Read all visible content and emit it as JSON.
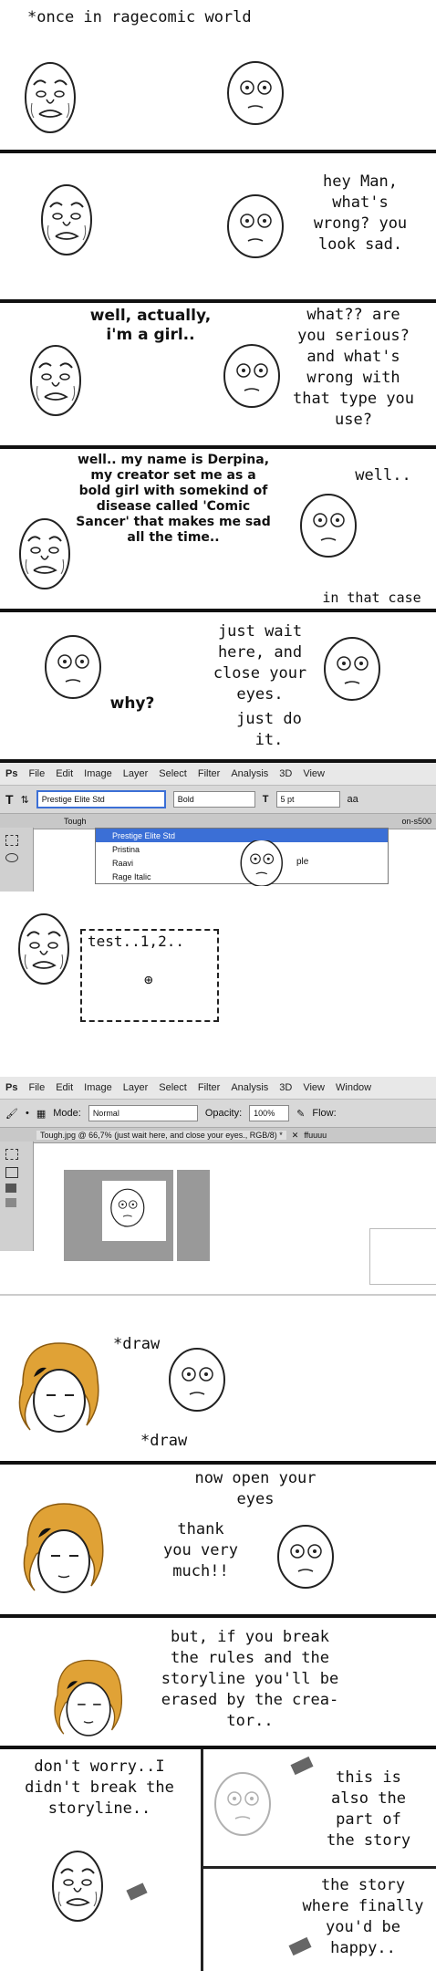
{
  "panels": {
    "p1": {
      "caption": "*once in ragecomic world"
    },
    "p2": {
      "speech": "hey Man,\nwhat's\nwrong? you\nlook sad."
    },
    "p3": {
      "girl": "well, actually,\ni'm a girl..",
      "man": "what?? are\nyou serious?\nand what's\nwrong with\nthat type you\nuse?"
    },
    "p4": {
      "girl": "well.. my name is Derpina,\nmy creator set me as a\nbold girl with somekind of\ndisease called 'Comic\nSancer' that makes me sad\nall the time..",
      "man1": "well..",
      "man2": "in that case"
    },
    "p5": {
      "man": "just wait\nhere, and\nclose your\neyes.",
      "girl": "why?",
      "man2": "just do\nit."
    },
    "p6": {
      "menu": [
        "File",
        "Edit",
        "Image",
        "Layer",
        "Select",
        "Filter",
        "Analysis",
        "3D",
        "View"
      ],
      "font_value": "Prestige Elite Std",
      "style_value": "Bold",
      "size_value": "5 pt",
      "aa": "aa",
      "tab_left": "Tough",
      "tab_right": "on-s500",
      "fonts": [
        "Prestige Elite Std",
        "Pristina",
        "Raavi",
        "Rage Italic"
      ],
      "side_a": "ple",
      "side_b": "ple"
    },
    "p7": {
      "textbox": "test..1,2.."
    },
    "p8": {
      "menu": [
        "File",
        "Edit",
        "Image",
        "Layer",
        "Select",
        "Filter",
        "Analysis",
        "3D",
        "View",
        "Window"
      ],
      "mode_label": "Mode:",
      "mode_value": "Normal",
      "opacity_label": "Opacity:",
      "opacity_value": "100%",
      "flow_label": "Flow:",
      "tab_title": "Tough.jpg @ 66,7% (just wait here, and close your eyes., RGB/8) *",
      "tab_right": "ffuuuu"
    },
    "p9": {
      "draw1": "*draw",
      "draw2": "*draw"
    },
    "p10": {
      "man": "now open your\neyes",
      "girl": "thank\nyou very\nmuch!!"
    },
    "p11": {
      "man": "but, if you break\nthe rules and the\nstoryline you'll be\nerased by the crea-\ntor.."
    },
    "p12": {
      "girl": "don't worry..I\ndidn't break the\nstoryline..",
      "man1": "this is\nalso the\npart of\nthe story",
      "man2": "the story\nwhere finally\nyou'd be\nhappy.."
    }
  }
}
